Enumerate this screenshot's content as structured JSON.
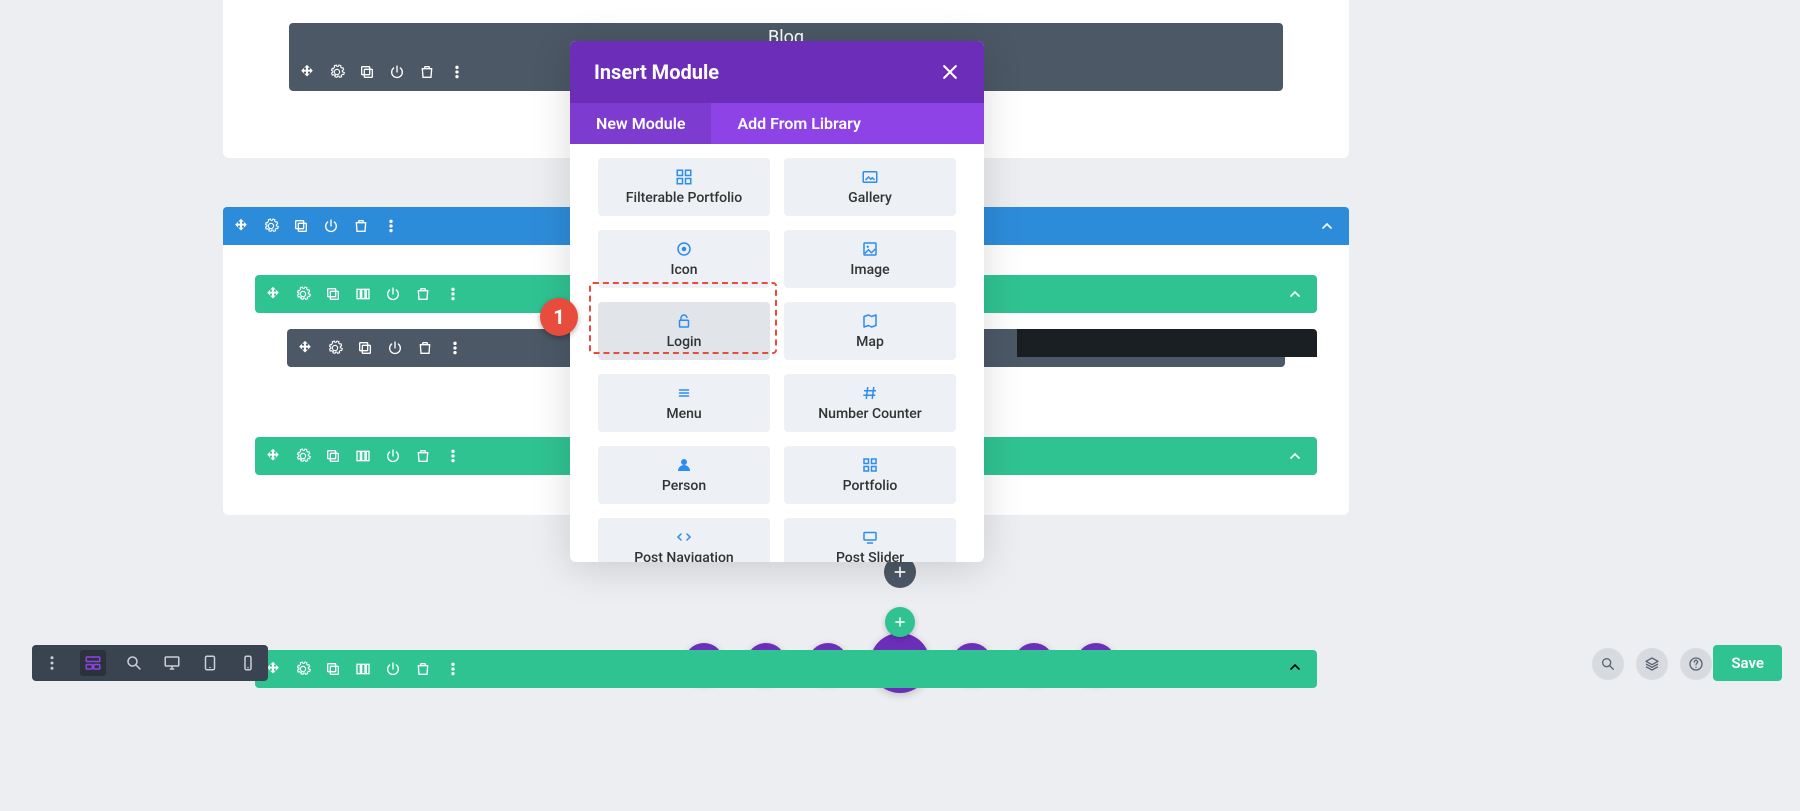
{
  "builder": {
    "blog_module_title": "Blog"
  },
  "modal": {
    "title": "Insert Module",
    "tabs": {
      "new": "New Module",
      "library": "Add From Library"
    },
    "items": [
      {
        "icon": "grid-filter",
        "label": "Filterable Portfolio"
      },
      {
        "icon": "gallery",
        "label": "Gallery"
      },
      {
        "icon": "target",
        "label": "Icon"
      },
      {
        "icon": "image",
        "label": "Image"
      },
      {
        "icon": "unlock",
        "label": "Login",
        "highlight": true
      },
      {
        "icon": "map",
        "label": "Map"
      },
      {
        "icon": "menu-lines",
        "label": "Menu"
      },
      {
        "icon": "hash",
        "label": "Number Counter"
      },
      {
        "icon": "person",
        "label": "Person"
      },
      {
        "icon": "portfolio-grid",
        "label": "Portfolio"
      },
      {
        "icon": "code-arrows",
        "label": "Post Navigation"
      },
      {
        "icon": "slider",
        "label": "Post Slider"
      }
    ]
  },
  "callout": {
    "number": "1"
  },
  "actions": {
    "save": "Save"
  }
}
